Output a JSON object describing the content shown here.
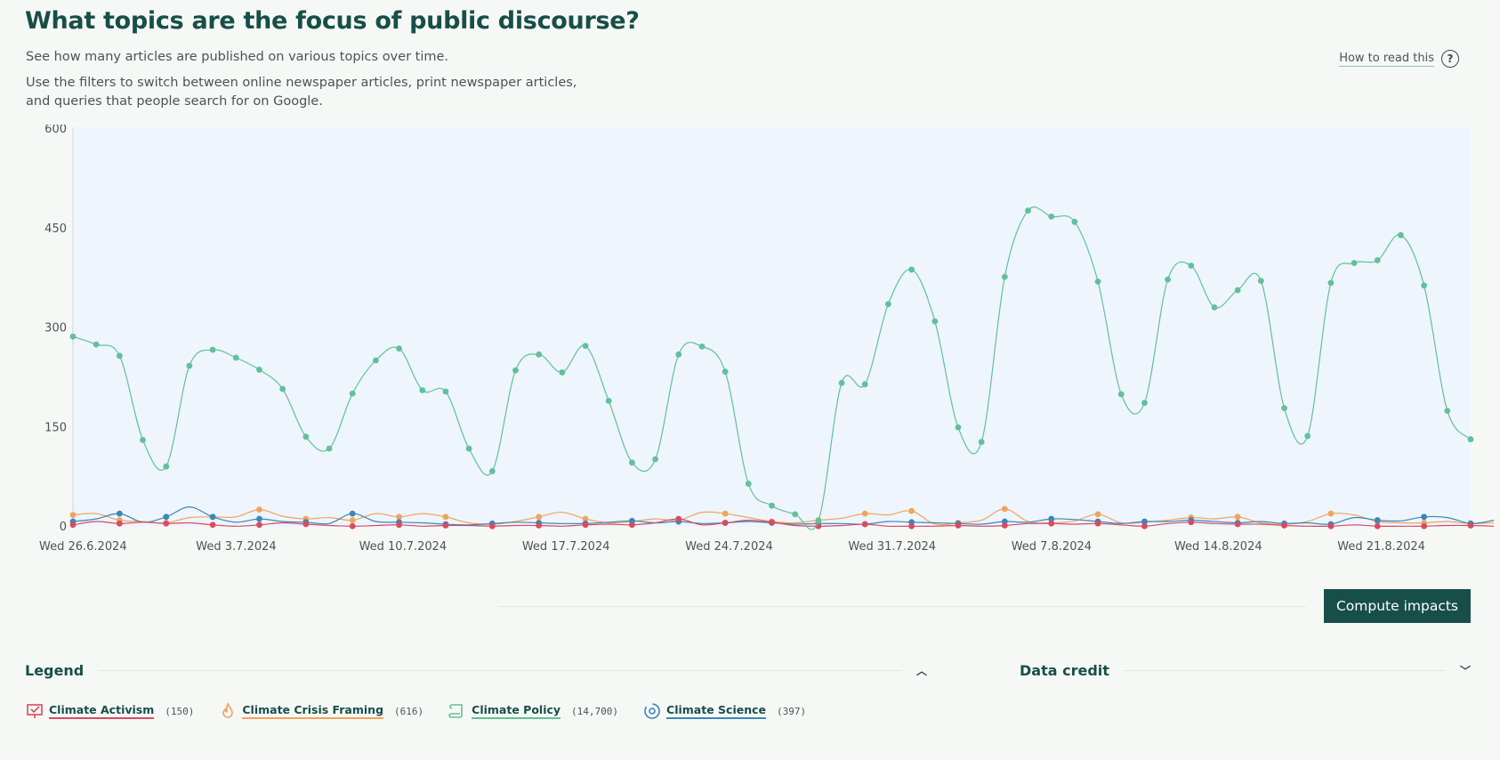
{
  "header": {
    "title": "What topics are the focus of public discourse?",
    "desc1": "See how many articles are published on various topics over time.",
    "desc2": "Use the filters to switch between online newspaper articles, print newspaper articles, and queries that people search for on Google.",
    "howto_label": "How to read this"
  },
  "compute_button_label": "Compute impacts",
  "legend": {
    "title": "Legend",
    "items": [
      {
        "label": "Climate Activism",
        "count": "(150)",
        "icon": "protest-sign-icon",
        "color": "#d94b61"
      },
      {
        "label": "Climate Crisis Framing",
        "count": "(616)",
        "icon": "flame-icon",
        "color": "#f0a45c"
      },
      {
        "label": "Climate Policy",
        "count": "(14,700)",
        "icon": "scroll-icon",
        "color": "#62c09a"
      },
      {
        "label": "Climate Science",
        "count": "(397)",
        "icon": "atom-icon",
        "color": "#3a87b8"
      }
    ]
  },
  "data_credit": {
    "title": "Data credit"
  },
  "colors": {
    "plot_bg": "#eef5fc",
    "policy": "#62c09a",
    "science": "#3a87b8",
    "framing": "#f0a45c",
    "activism": "#d94b61"
  },
  "chart_data": {
    "type": "line",
    "x_start": "2024-06-26",
    "x_end": "2024-08-26",
    "ylim": [
      0,
      600
    ],
    "yticks": [
      0,
      150,
      300,
      450,
      600
    ],
    "xtick_labels": [
      "Wed 26.6.2024",
      "Wed 3.7.2024",
      "Wed 10.7.2024",
      "Wed 17.7.2024",
      "Wed 24.7.2024",
      "Wed 31.7.2024",
      "Wed 7.8.2024",
      "Wed 14.8.2024",
      "Wed 21.8.2024"
    ],
    "series": [
      {
        "name": "Climate Policy",
        "color": "#62c09a",
        "values": [
          287,
          275,
          258,
          131,
          91,
          243,
          267,
          255,
          237,
          208,
          136,
          118,
          201,
          251,
          269,
          206,
          204,
          118,
          84,
          236,
          260,
          233,
          273,
          190,
          97,
          102,
          260,
          272,
          234,
          65,
          32,
          19,
          9,
          217,
          215,
          336,
          388,
          310,
          150,
          128,
          377,
          477,
          468,
          460,
          370,
          200,
          187,
          373,
          394,
          331,
          357,
          371,
          179,
          137,
          368,
          398,
          402,
          440,
          364,
          175,
          132
        ]
      },
      {
        "name": "Climate Science",
        "color": "#3a87b8",
        "values": [
          8,
          12,
          20,
          7,
          15,
          30,
          15,
          7,
          12,
          8,
          7,
          5,
          20,
          8,
          7,
          6,
          4,
          3,
          5,
          7,
          6,
          5,
          5,
          7,
          9,
          6,
          8,
          5,
          6,
          8,
          6,
          4,
          5,
          5,
          4,
          8,
          7,
          6,
          5,
          4,
          8,
          7,
          12,
          11,
          8,
          5,
          8,
          8,
          10,
          8,
          6,
          8,
          5,
          6,
          4,
          14,
          10,
          9,
          15,
          14,
          5,
          10
        ]
      },
      {
        "name": "Climate Crisis Framing",
        "color": "#f0a45c",
        "values": [
          18,
          20,
          10,
          8,
          6,
          14,
          15,
          15,
          26,
          16,
          12,
          14,
          10,
          20,
          15,
          20,
          15,
          6,
          4,
          8,
          15,
          22,
          12,
          6,
          8,
          12,
          10,
          22,
          20,
          14,
          8,
          6,
          10,
          13,
          20,
          18,
          24,
          4,
          6,
          10,
          27,
          8,
          6,
          9,
          19,
          6,
          7,
          10,
          14,
          12,
          15,
          6,
          4,
          8,
          20,
          18,
          8,
          6,
          6,
          8,
          5,
          6
        ]
      },
      {
        "name": "Climate Activism",
        "color": "#d94b61",
        "values": [
          3,
          8,
          5,
          7,
          5,
          6,
          3,
          1,
          3,
          6,
          4,
          2,
          1,
          2,
          3,
          1,
          2,
          2,
          1,
          2,
          2,
          1,
          3,
          4,
          3,
          6,
          12,
          3,
          6,
          10,
          7,
          2,
          1,
          2,
          4,
          1,
          1,
          1,
          2,
          1,
          2,
          5,
          5,
          4,
          5,
          3,
          1,
          5,
          7,
          5,
          4,
          4,
          2,
          1,
          1,
          3,
          1,
          1,
          1,
          2,
          2,
          1
        ]
      }
    ]
  }
}
